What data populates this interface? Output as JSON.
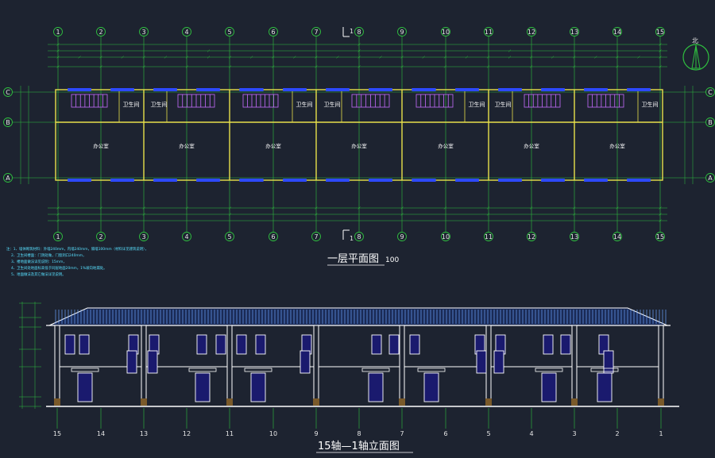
{
  "axes_top": [
    "1",
    "2",
    "3",
    "4",
    "5",
    "6",
    "7",
    "8",
    "9",
    "10",
    "11",
    "12",
    "13",
    "14",
    "15"
  ],
  "axes_side": [
    "C",
    "B",
    "A"
  ],
  "elev_axes": [
    "15",
    "14",
    "13",
    "12",
    "11",
    "10",
    "9",
    "8",
    "7",
    "6",
    "5",
    "4",
    "3",
    "2",
    "1"
  ],
  "rooms": {
    "office": "办公室",
    "toilet": "卫生间"
  },
  "notes": [
    "注：1、墙体砌筑材料：外墙240mm，内墙240mm，隔墙100mm（材料详见建筑说明），",
    "2、卫生间楼面：门洞处做，门窗洞口240mm，",
    "3、楼地面做法详见说明：15mm，",
    "4、卫生间处地面标高低于同层地面20mm，1%坡向地漏处。",
    "5、地面做法及其它做法详见说明。"
  ],
  "titles": {
    "plan": "一层平面图",
    "plan_scale": "100",
    "elevation": "15轴—1轴立面图"
  },
  "section_marks": {
    "top": "1",
    "bottom": "1"
  },
  "north_label": "北",
  "colors": {
    "background": "#1d2330",
    "grid": "#2fbf3f",
    "wall": "#e8e04a",
    "window": "#2d49ff",
    "stair": "#c76bff",
    "notes": "#58e0ff",
    "roof": "#6aa3ff"
  }
}
